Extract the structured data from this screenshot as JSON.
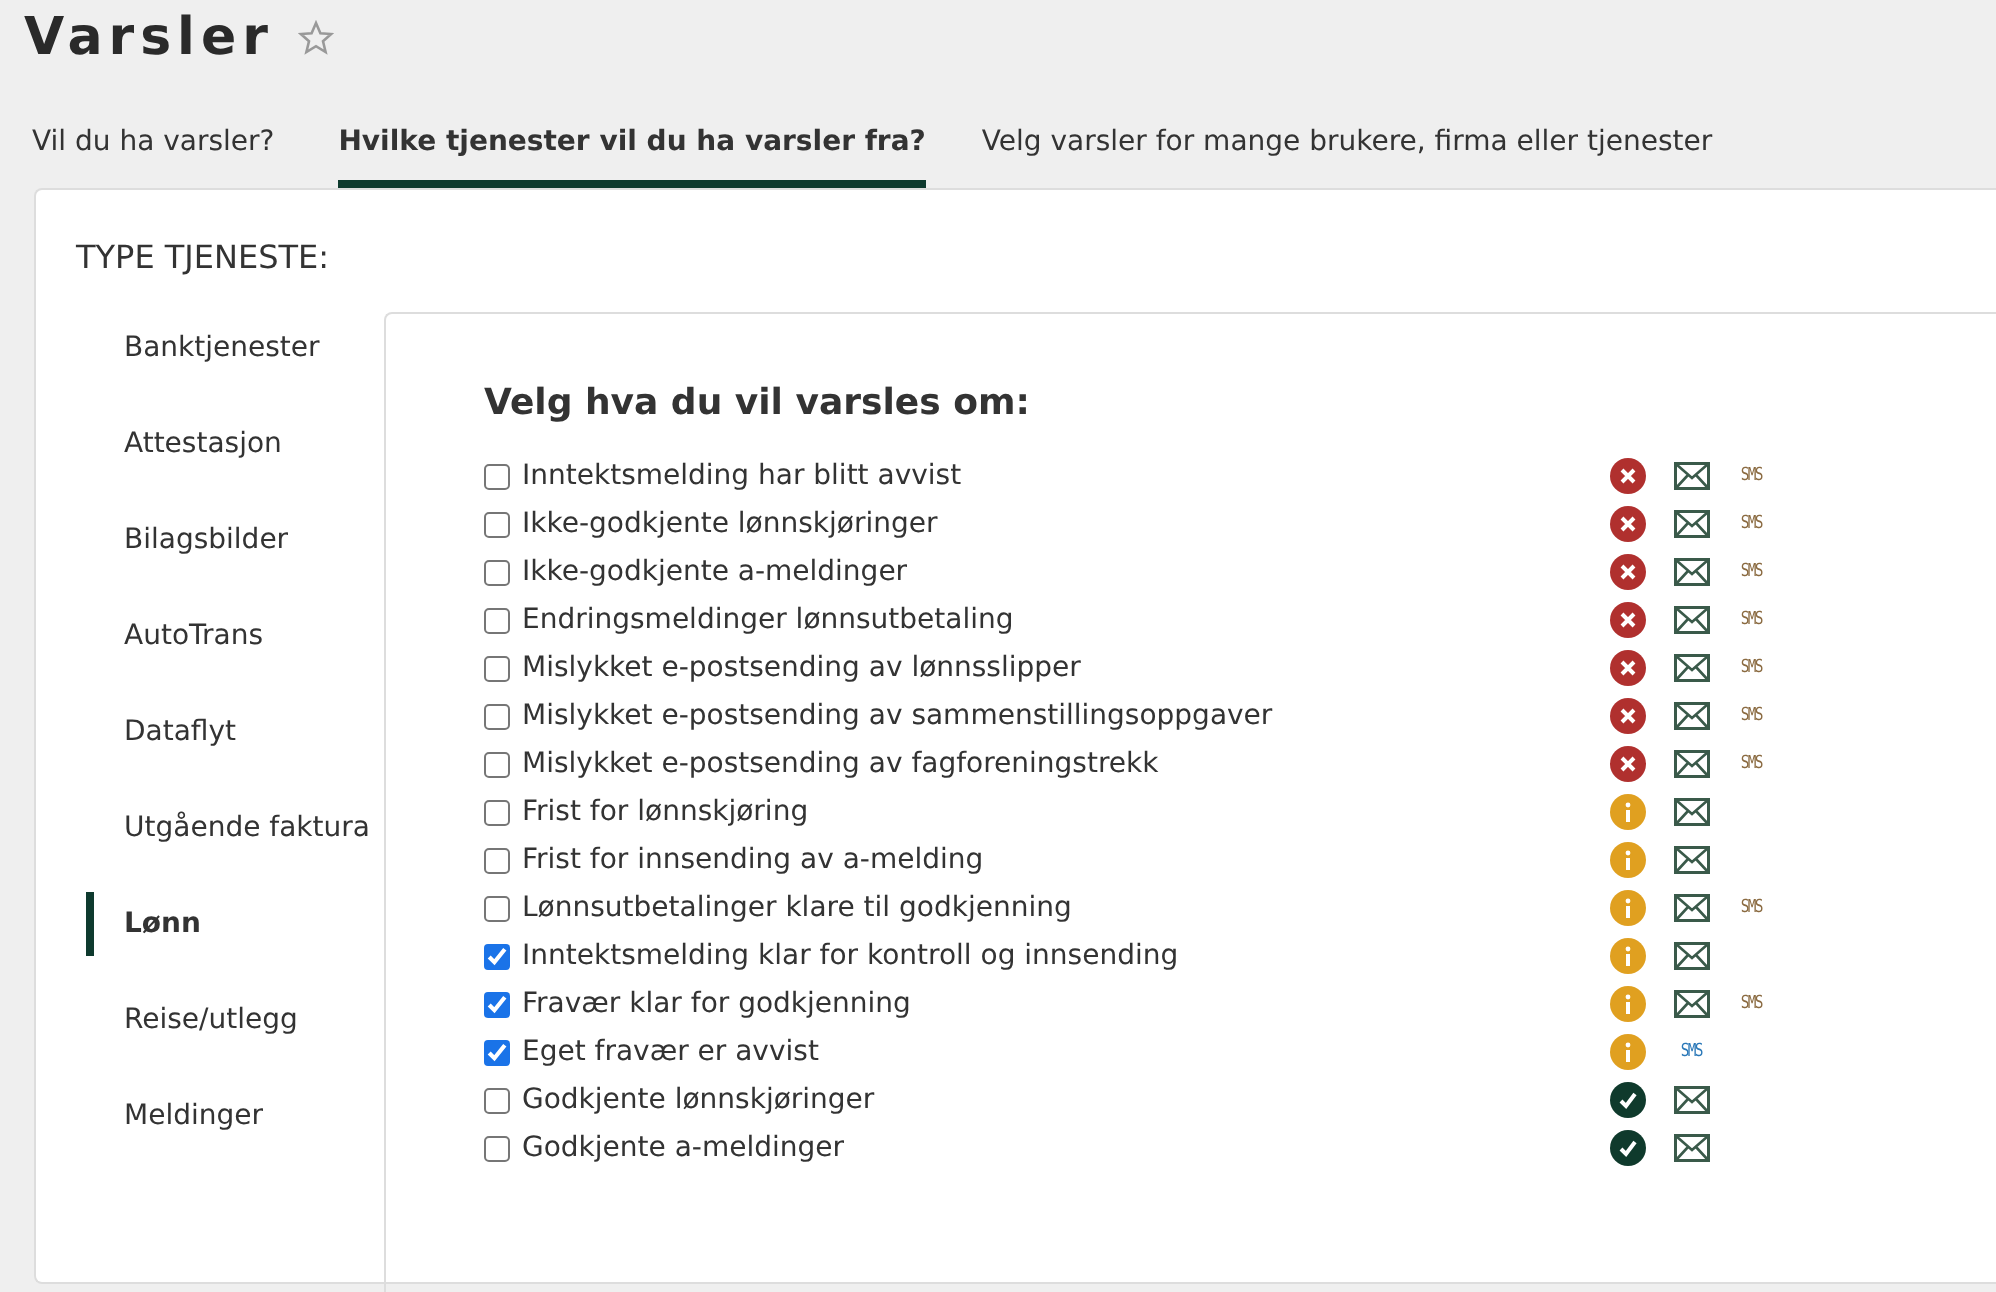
{
  "page": {
    "title": "Varsler",
    "favorite": false
  },
  "tabs": [
    {
      "label": "Vil du ha varsler?",
      "selected": false
    },
    {
      "label": "Hvilke tjenester vil du ha varsler fra?",
      "selected": true
    },
    {
      "label": "Velg varsler for mange brukere, firma eller tjenester",
      "selected": false
    }
  ],
  "section_title": "TYPE TJENESTE:",
  "sidebar": {
    "items": [
      {
        "label": "Banktjenester",
        "selected": false
      },
      {
        "label": "Attestasjon",
        "selected": false
      },
      {
        "label": "Bilagsbilder",
        "selected": false
      },
      {
        "label": "AutoTrans",
        "selected": false
      },
      {
        "label": "Dataflyt",
        "selected": false
      },
      {
        "label": "Utgående faktura",
        "selected": false
      },
      {
        "label": "Lønn",
        "selected": true
      },
      {
        "label": "Reise/utlegg",
        "selected": false
      },
      {
        "label": "Meldinger",
        "selected": false
      }
    ]
  },
  "panel": {
    "heading": "Velg hva du vil varsles om:",
    "notifications": [
      {
        "label": "Inntektsmelding har blitt avvist",
        "checked": false,
        "kind": "error",
        "email": true,
        "sms": "SMS"
      },
      {
        "label": "Ikke-godkjente lønnskjøringer",
        "checked": false,
        "kind": "error",
        "email": true,
        "sms": "SMS"
      },
      {
        "label": "Ikke-godkjente a-meldinger",
        "checked": false,
        "kind": "error",
        "email": true,
        "sms": "SMS"
      },
      {
        "label": "Endringsmeldinger lønnsutbetaling",
        "checked": false,
        "kind": "error",
        "email": true,
        "sms": "SMS"
      },
      {
        "label": "Mislykket e-postsending av lønnsslipper",
        "checked": false,
        "kind": "error",
        "email": true,
        "sms": "SMS"
      },
      {
        "label": "Mislykket e-postsending av sammenstillingsoppgaver",
        "checked": false,
        "kind": "error",
        "email": true,
        "sms": "SMS"
      },
      {
        "label": "Mislykket e-postsending av fagforeningstrekk",
        "checked": false,
        "kind": "error",
        "email": true,
        "sms": "SMS"
      },
      {
        "label": "Frist for lønnskjøring",
        "checked": false,
        "kind": "info",
        "email": true
      },
      {
        "label": "Frist for innsending av a-melding",
        "checked": false,
        "kind": "info",
        "email": true
      },
      {
        "label": "Lønnsutbetalinger klare til godkjenning",
        "checked": false,
        "kind": "info",
        "email": true,
        "sms": "SMS"
      },
      {
        "label": "Inntektsmelding klar for kontroll og innsending",
        "checked": true,
        "kind": "info",
        "email": true
      },
      {
        "label": "Fravær klar for godkjenning",
        "checked": true,
        "kind": "info",
        "email": true,
        "sms": "SMS"
      },
      {
        "label": "Eget fravær er avvist",
        "checked": true,
        "kind": "info",
        "email": false,
        "sms": "SMS"
      },
      {
        "label": "Godkjente lønnskjøringer",
        "checked": false,
        "kind": "success",
        "email": true
      },
      {
        "label": "Godkjente a-meldinger",
        "checked": false,
        "kind": "success",
        "email": true
      }
    ]
  }
}
